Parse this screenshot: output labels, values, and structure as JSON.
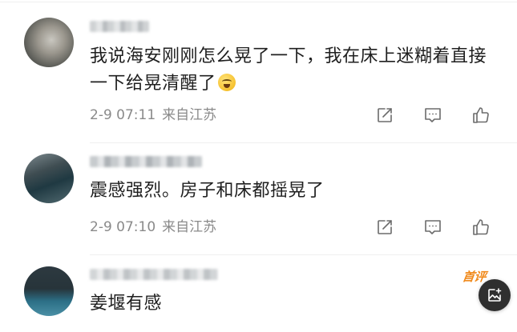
{
  "comments": [
    {
      "text": "我说海安刚刚怎么晃了一下，我在床上迷糊着直接一下给晃清醒了",
      "emoji": "laughing-tears-emoji",
      "date": "2-9 07:11",
      "location": "来自江苏"
    },
    {
      "text": "震感强烈。房子和床都摇晃了",
      "date": "2-9 07:10",
      "location": "来自江苏"
    },
    {
      "text": "姜堰有感"
    }
  ],
  "badge": {
    "label": "首评",
    "color": "#f08a1c"
  },
  "icons": {
    "share": "share-icon",
    "comment": "comment-icon",
    "like": "thumbs-up-icon",
    "fab": "compose-image-icon"
  },
  "colors": {
    "text": "#1f1f1f",
    "meta": "#8a8a8a",
    "icon": "#6b6b6b",
    "fab_bg": "#2f2f2f"
  }
}
